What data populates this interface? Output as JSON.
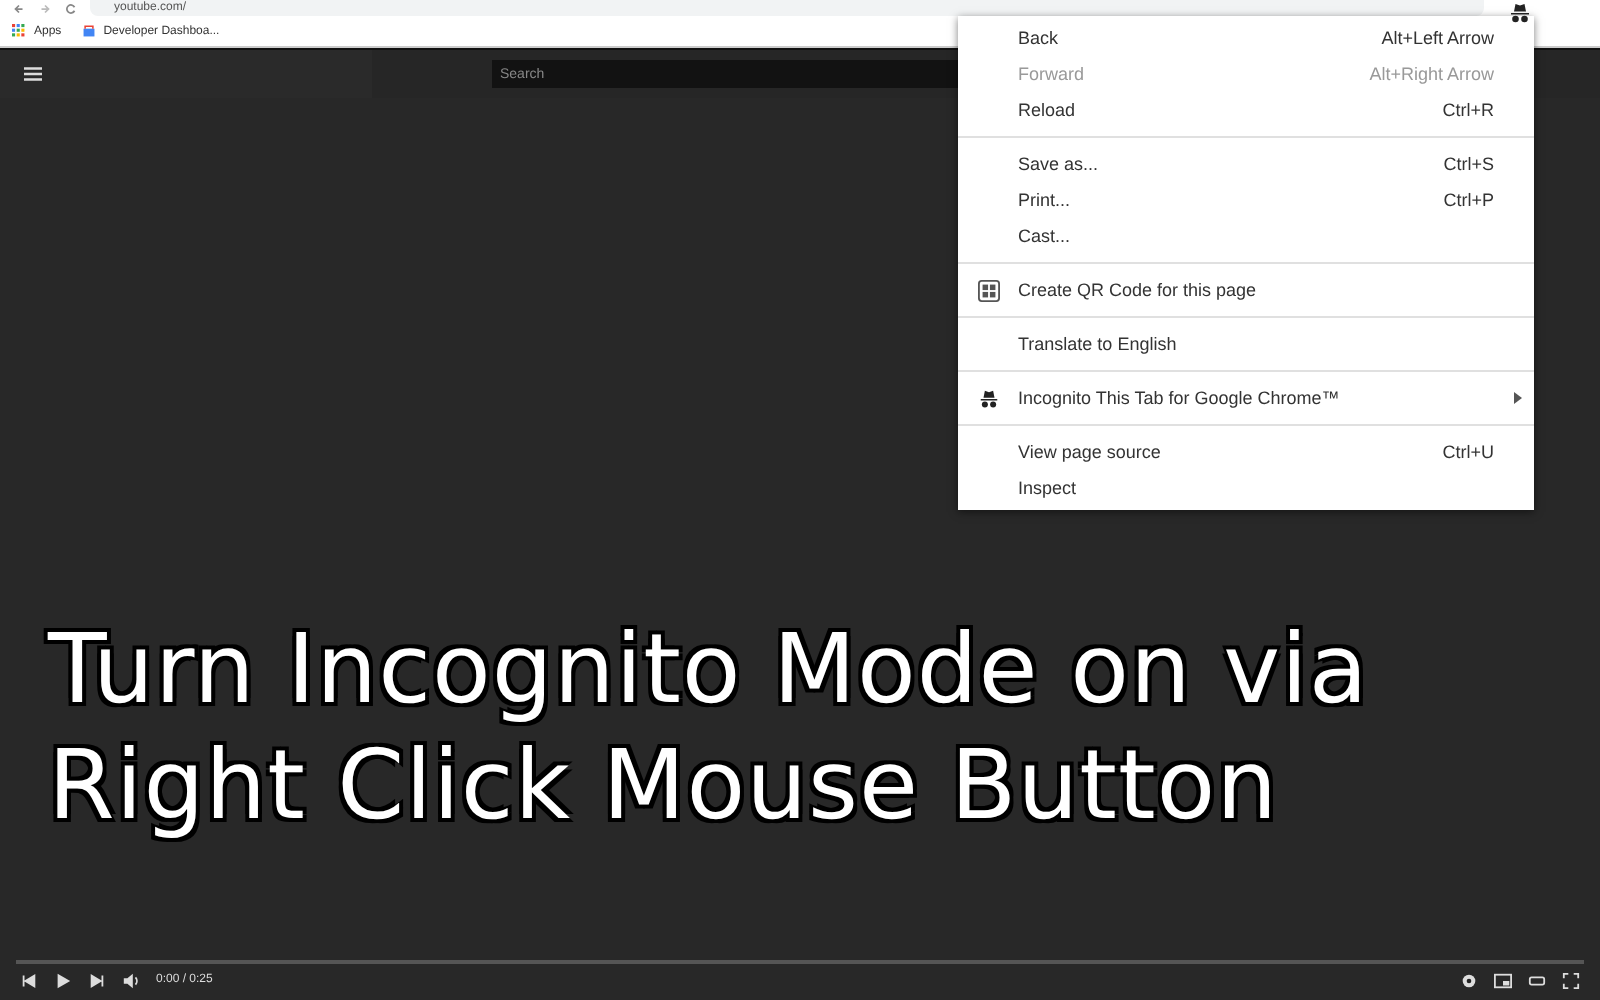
{
  "browser": {
    "url": "youtube.com/",
    "bookmarks": [
      {
        "label": "Apps",
        "kind": "apps"
      },
      {
        "label": "Developer Dashboa...",
        "kind": "store"
      }
    ]
  },
  "page": {
    "search": {
      "placeholder": "Search"
    },
    "title_lines": [
      "Turn Incognito Mode on via",
      "Right Click Mouse Button"
    ],
    "player": {
      "time": "0:00 / 0:25"
    }
  },
  "context_menu": {
    "groups": [
      [
        {
          "label": "Back",
          "shortcut": "Alt+Left Arrow",
          "kind": "plain",
          "disabled": false,
          "submenu": false
        },
        {
          "label": "Forward",
          "shortcut": "Alt+Right Arrow",
          "kind": "plain",
          "disabled": true,
          "submenu": false
        },
        {
          "label": "Reload",
          "shortcut": "Ctrl+R",
          "kind": "plain",
          "disabled": false,
          "submenu": false
        }
      ],
      [
        {
          "label": "Save as...",
          "shortcut": "Ctrl+S",
          "kind": "plain",
          "disabled": false,
          "submenu": false
        },
        {
          "label": "Print...",
          "shortcut": "Ctrl+P",
          "kind": "plain",
          "disabled": false,
          "submenu": false
        },
        {
          "label": "Cast...",
          "kind": "plain",
          "disabled": false,
          "submenu": false
        }
      ],
      [
        {
          "label": "Create QR Code for this page",
          "kind": "qr",
          "disabled": false,
          "submenu": false
        }
      ],
      [
        {
          "label": "Translate to English",
          "kind": "plain",
          "disabled": false,
          "submenu": false
        }
      ],
      [
        {
          "label": "Incognito This Tab for Google Chrome™",
          "kind": "incognito",
          "disabled": false,
          "submenu": true
        }
      ],
      [
        {
          "label": "View page source",
          "shortcut": "Ctrl+U",
          "kind": "plain",
          "disabled": false,
          "submenu": false
        },
        {
          "label": "Inspect",
          "kind": "plain",
          "disabled": false,
          "submenu": false
        }
      ]
    ]
  }
}
